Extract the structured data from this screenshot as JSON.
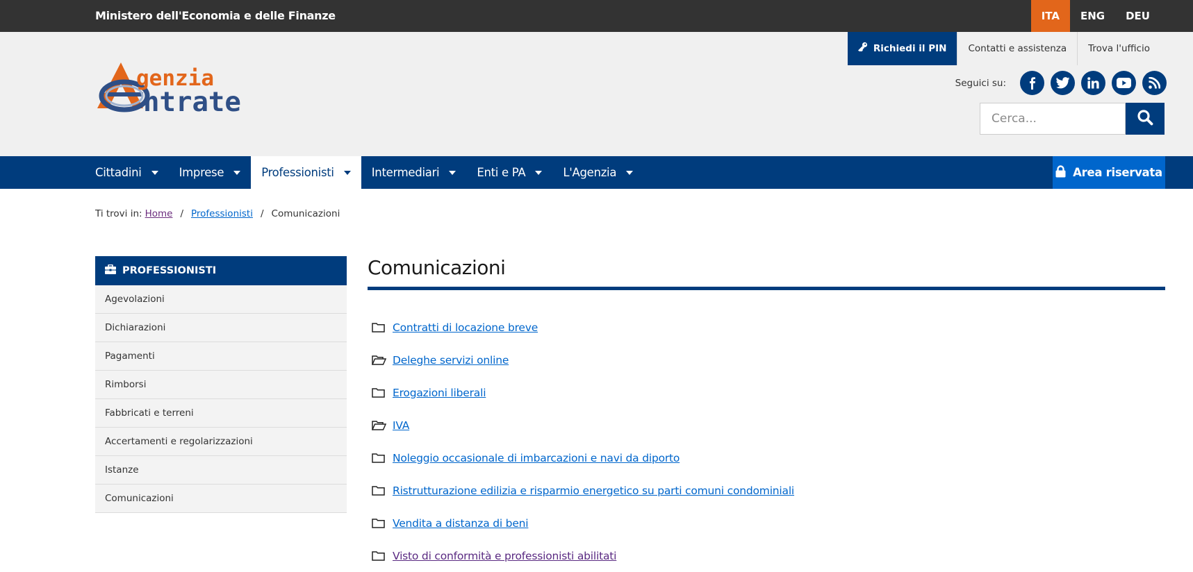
{
  "topbar": {
    "ministry": "Ministero dell'Economia e delle Finanze",
    "languages": [
      "ITA",
      "ENG",
      "DEU"
    ],
    "active_language": "ITA"
  },
  "header": {
    "logo_text_top": "genzia",
    "logo_text_bottom": "ntrate",
    "links": {
      "pin": "Richiedi il PIN",
      "contacts": "Contatti e assistenza",
      "office": "Trova l'ufficio"
    },
    "social_label": "Seguici su:",
    "social": [
      "facebook-icon",
      "twitter-icon",
      "linkedin-icon",
      "youtube-icon",
      "rss-icon"
    ],
    "search_placeholder": "Cerca..."
  },
  "nav": {
    "items": [
      "Cittadini",
      "Imprese",
      "Professionisti",
      "Intermediari",
      "Enti e PA",
      "L'Agenzia"
    ],
    "active": "Professionisti",
    "reserved_area": "Area riservata"
  },
  "breadcrumb": {
    "prefix": "Ti trovi in:",
    "items": [
      "Home",
      "Professionisti",
      "Comunicazioni"
    ],
    "separator": "/"
  },
  "sidebar": {
    "title": "PROFESSIONISTI",
    "items": [
      "Agevolazioni",
      "Dichiarazioni",
      "Pagamenti",
      "Rimborsi",
      "Fabbricati e terreni",
      "Accertamenti e regolarizzazioni",
      "Istanze",
      "Comunicazioni"
    ]
  },
  "main": {
    "title": "Comunicazioni",
    "links": [
      {
        "label": "Contratti di locazione breve",
        "icon": "folder-icon"
      },
      {
        "label": "Deleghe servizi online",
        "icon": "folder-open-icon"
      },
      {
        "label": "Erogazioni liberali",
        "icon": "folder-icon"
      },
      {
        "label": "IVA",
        "icon": "folder-open-icon"
      },
      {
        "label": "Noleggio occasionale di imbarcazioni e navi da diporto",
        "icon": "folder-icon"
      },
      {
        "label": "Ristrutturazione edilizia e risparmio energetico su parti comuni condominiali",
        "icon": "folder-icon"
      },
      {
        "label": "Vendita a distanza di beni",
        "icon": "folder-icon"
      },
      {
        "label": "Visto di conformità e professionisti abilitati",
        "icon": "folder-icon"
      }
    ]
  },
  "colors": {
    "primary": "#003c7d",
    "accent": "#e2661b",
    "link": "#0066cc",
    "reserved": "#0066cc"
  }
}
